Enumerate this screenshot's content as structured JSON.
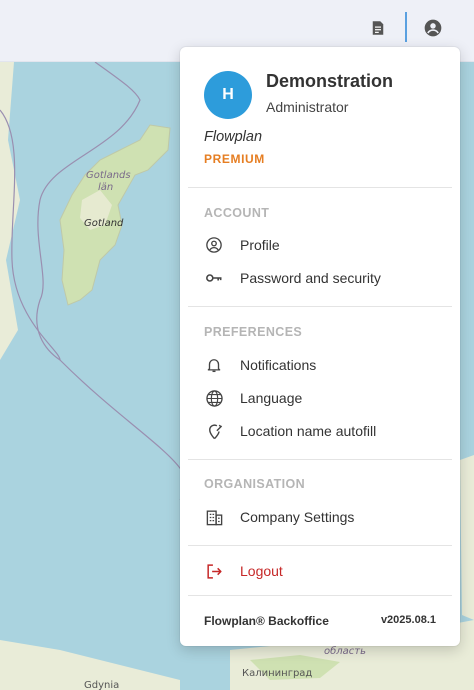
{
  "map": {
    "labels": {
      "gotlands_lan_1": "Gotlands",
      "gotlands_lan_2": "län",
      "gotland": "Gotland",
      "gdynia": "Gdynia",
      "kaliningrad": "Калининград",
      "oblast": "область"
    },
    "colors": {
      "sea": "#aad3df",
      "land": "#e9ecd8",
      "forest": "#cfe1b2",
      "border": "#9a8fb0"
    }
  },
  "topbar": {
    "icons": {
      "documents": "document-icon",
      "account": "account-circle-icon"
    },
    "divider_color": "#5aa0e0"
  },
  "user": {
    "avatar_initial": "H",
    "name": "Demonstration",
    "role": "Administrator",
    "company": "Flowplan",
    "plan": "PREMIUM",
    "avatar_color": "#2d9cdb",
    "plan_color": "#e67e22"
  },
  "sections": {
    "account": {
      "title": "ACCOUNT",
      "items": [
        {
          "label": "Profile",
          "icon": "profile-icon"
        },
        {
          "label": "Password and security",
          "icon": "key-icon"
        }
      ]
    },
    "preferences": {
      "title": "PREFERENCES",
      "items": [
        {
          "label": "Notifications",
          "icon": "bell-icon"
        },
        {
          "label": "Language",
          "icon": "globe-icon"
        },
        {
          "label": "Location name autofill",
          "icon": "location-edit-icon"
        }
      ]
    },
    "organisation": {
      "title": "ORGANISATION",
      "items": [
        {
          "label": "Company Settings",
          "icon": "building-icon"
        }
      ]
    }
  },
  "logout": {
    "label": "Logout",
    "icon": "logout-icon",
    "color": "#c62828"
  },
  "footer": {
    "brand": "Flowplan® Backoffice",
    "version": "v2025.08.1"
  }
}
